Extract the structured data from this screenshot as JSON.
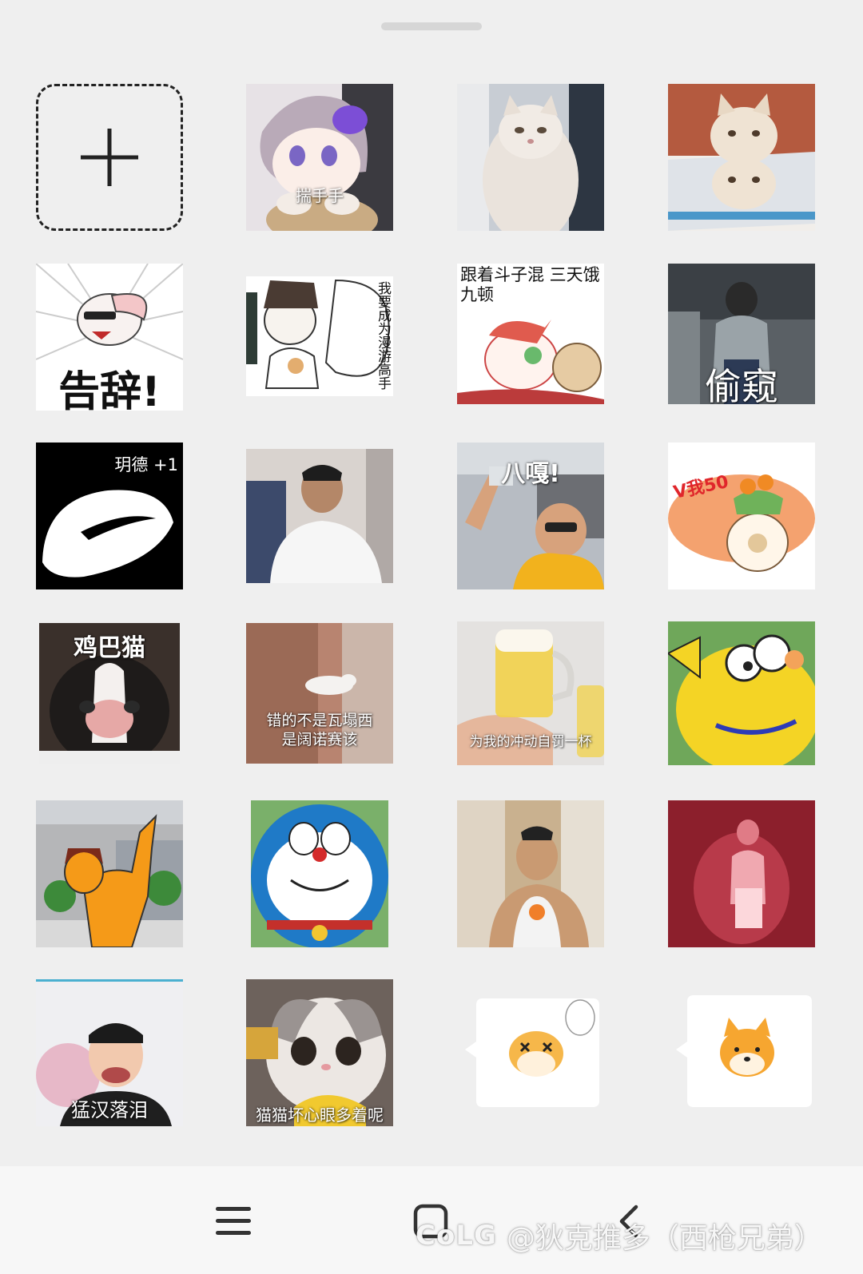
{
  "stickers": [
    {
      "caption": "揣手手"
    },
    {
      "caption": ""
    },
    {
      "caption": ""
    },
    {
      "caption": "告辞!"
    },
    {
      "caption": "我要成为漫游高手"
    },
    {
      "caption": "跟着斗子混 三天饿九顿"
    },
    {
      "caption": "偷窥"
    },
    {
      "caption": "玥德 +1"
    },
    {
      "caption": ""
    },
    {
      "caption": "八嘎!"
    },
    {
      "caption": "V我50"
    },
    {
      "caption": "鸡巴猫"
    },
    {
      "caption": "错的不是瓦塌西 是阔诺赛该"
    },
    {
      "caption": "为我的冲动自罚一杯"
    },
    {
      "caption": ""
    },
    {
      "caption": ""
    },
    {
      "caption": ""
    },
    {
      "caption": ""
    },
    {
      "caption": ""
    },
    {
      "caption": "猛汉落泪"
    },
    {
      "caption": "猫猫坏心眼多着呢"
    },
    {
      "caption": ""
    },
    {
      "caption": ""
    }
  ],
  "watermark": {
    "logo": "CoLG",
    "text": "@狄克推多（西枪兄弟）"
  },
  "colors": {
    "background": "#efefef",
    "navbar": "#f7f7f7",
    "icon": "#333333"
  }
}
